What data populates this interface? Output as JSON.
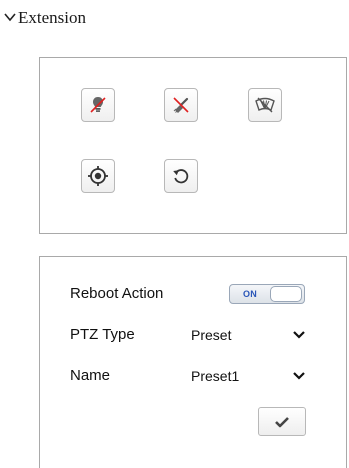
{
  "section": {
    "title": "Extension",
    "expanded_icon": "chevron-down-icon"
  },
  "ptz_controls": [
    {
      "name": "light-button",
      "icon": "light-bulb-icon",
      "state": "off"
    },
    {
      "name": "brush-button",
      "icon": "brush-icon",
      "state": "off"
    },
    {
      "name": "wiper-button",
      "icon": "windshield-wiper-icon",
      "state": "off"
    },
    {
      "name": "focus-button",
      "icon": "target-icon"
    },
    {
      "name": "reset-button",
      "icon": "rotate-counterclockwise-icon"
    }
  ],
  "reboot_action": {
    "label": "Reboot Action",
    "toggle_text": "ON",
    "enabled": true
  },
  "ptz_type": {
    "label": "PTZ Type",
    "value": "Preset"
  },
  "name": {
    "label": "Name",
    "value": "Preset1"
  },
  "apply": {
    "icon": "checkmark-icon"
  },
  "colors": {
    "border": "#a9a9a9",
    "toggle_text": "#2a56b8",
    "icon_dark": "#444444"
  }
}
